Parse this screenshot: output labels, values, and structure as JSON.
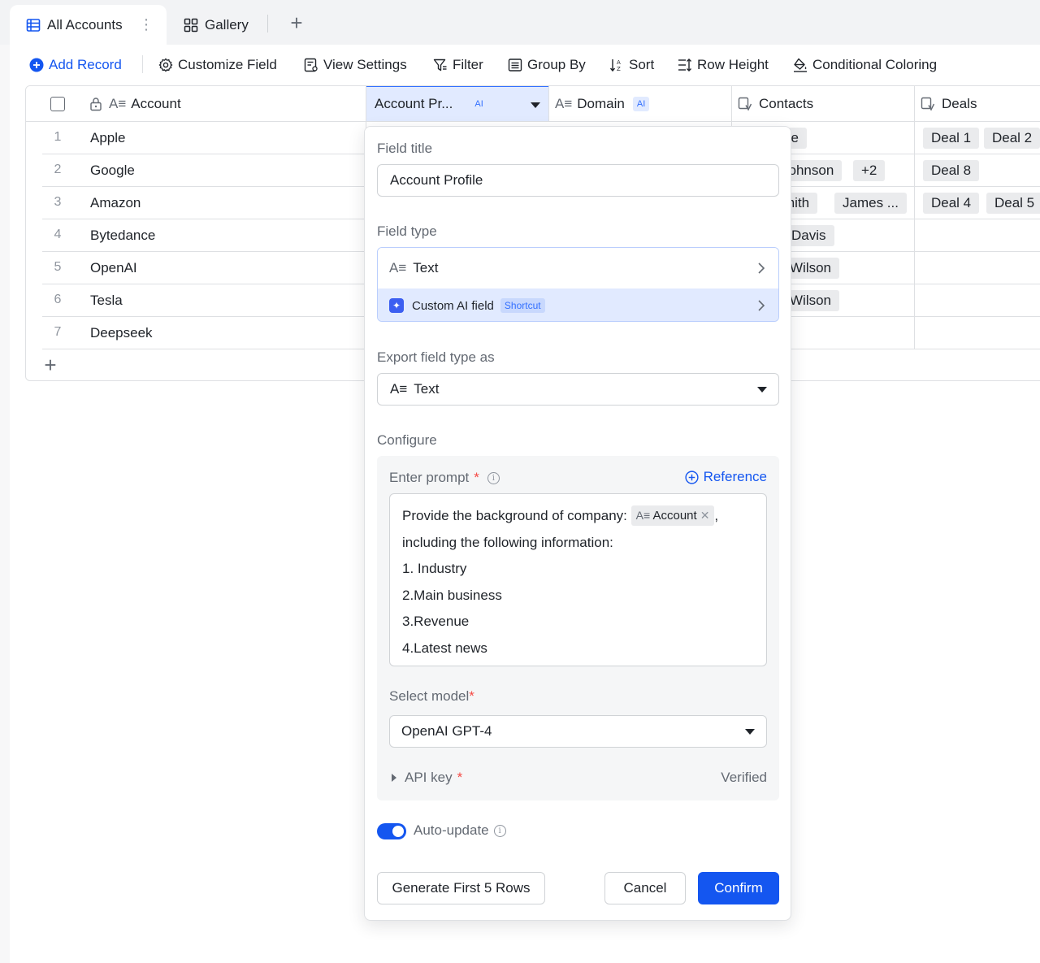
{
  "tabs": {
    "active_label": "All Accounts",
    "gallery_label": "Gallery"
  },
  "toolbar": {
    "add_record": "Add Record",
    "customize_field": "Customize Field",
    "view_settings": "View Settings",
    "filter": "Filter",
    "group_by": "Group By",
    "sort": "Sort",
    "row_height": "Row Height",
    "conditional_coloring": "Conditional Coloring"
  },
  "grid": {
    "columns": {
      "account": "Account",
      "account_profile": "Account Pr...",
      "ai_badge": "AI",
      "domain": "Domain",
      "contacts": "Contacts",
      "deals": "Deals"
    },
    "rows": [
      {
        "num": "1",
        "account": "Apple",
        "contacts": [
          "oe"
        ],
        "deals": [
          "Deal 1",
          "Deal 2"
        ]
      },
      {
        "num": "2",
        "account": "Google",
        "contacts": [
          "Johnson",
          "+2"
        ],
        "deals": [
          "Deal 8"
        ]
      },
      {
        "num": "3",
        "account": "Amazon",
        "contacts": [
          "mith",
          "James ..."
        ],
        "deals": [
          "Deal 4",
          "Deal 5"
        ]
      },
      {
        "num": "4",
        "account": "Bytedance",
        "contacts": [
          "Davis"
        ],
        "deals": []
      },
      {
        "num": "5",
        "account": "OpenAI",
        "contacts": [
          "Wilson"
        ],
        "deals": []
      },
      {
        "num": "6",
        "account": "Tesla",
        "contacts": [
          "Wilson"
        ],
        "deals": []
      },
      {
        "num": "7",
        "account": "Deepseek",
        "contacts": [],
        "deals": []
      }
    ]
  },
  "popup": {
    "field_title_label": "Field title",
    "field_title_value": "Account Profile",
    "field_type_label": "Field type",
    "type_text": "Text",
    "type_custom_ai": "Custom AI field",
    "shortcut_badge": "Shortcut",
    "export_label": "Export field type as",
    "export_value": "Text",
    "configure_label": "Configure",
    "prompt_label": "Enter prompt",
    "required_mark": "*",
    "reference_label": "Reference",
    "prompt": {
      "line1_pre": "Provide the background of company:",
      "tag": "Account",
      "line1_post": ",",
      "line2": "including the following information:",
      "line3": "1. Industry",
      "line4": "2.Main business",
      "line5": "3.Revenue",
      "line6": "4.Latest news"
    },
    "model_label": "Select model",
    "model_value": "OpenAI GPT-4",
    "api_key_label": "API key",
    "api_key_status": "Verified",
    "auto_update_label": "Auto-update",
    "auto_update_on": true,
    "generate_button": "Generate First 5 Rows",
    "cancel_button": "Cancel",
    "confirm_button": "Confirm"
  },
  "colors": {
    "accent": "#1456f0",
    "selected_header": "#e1eaff",
    "required": "#f54a45"
  }
}
